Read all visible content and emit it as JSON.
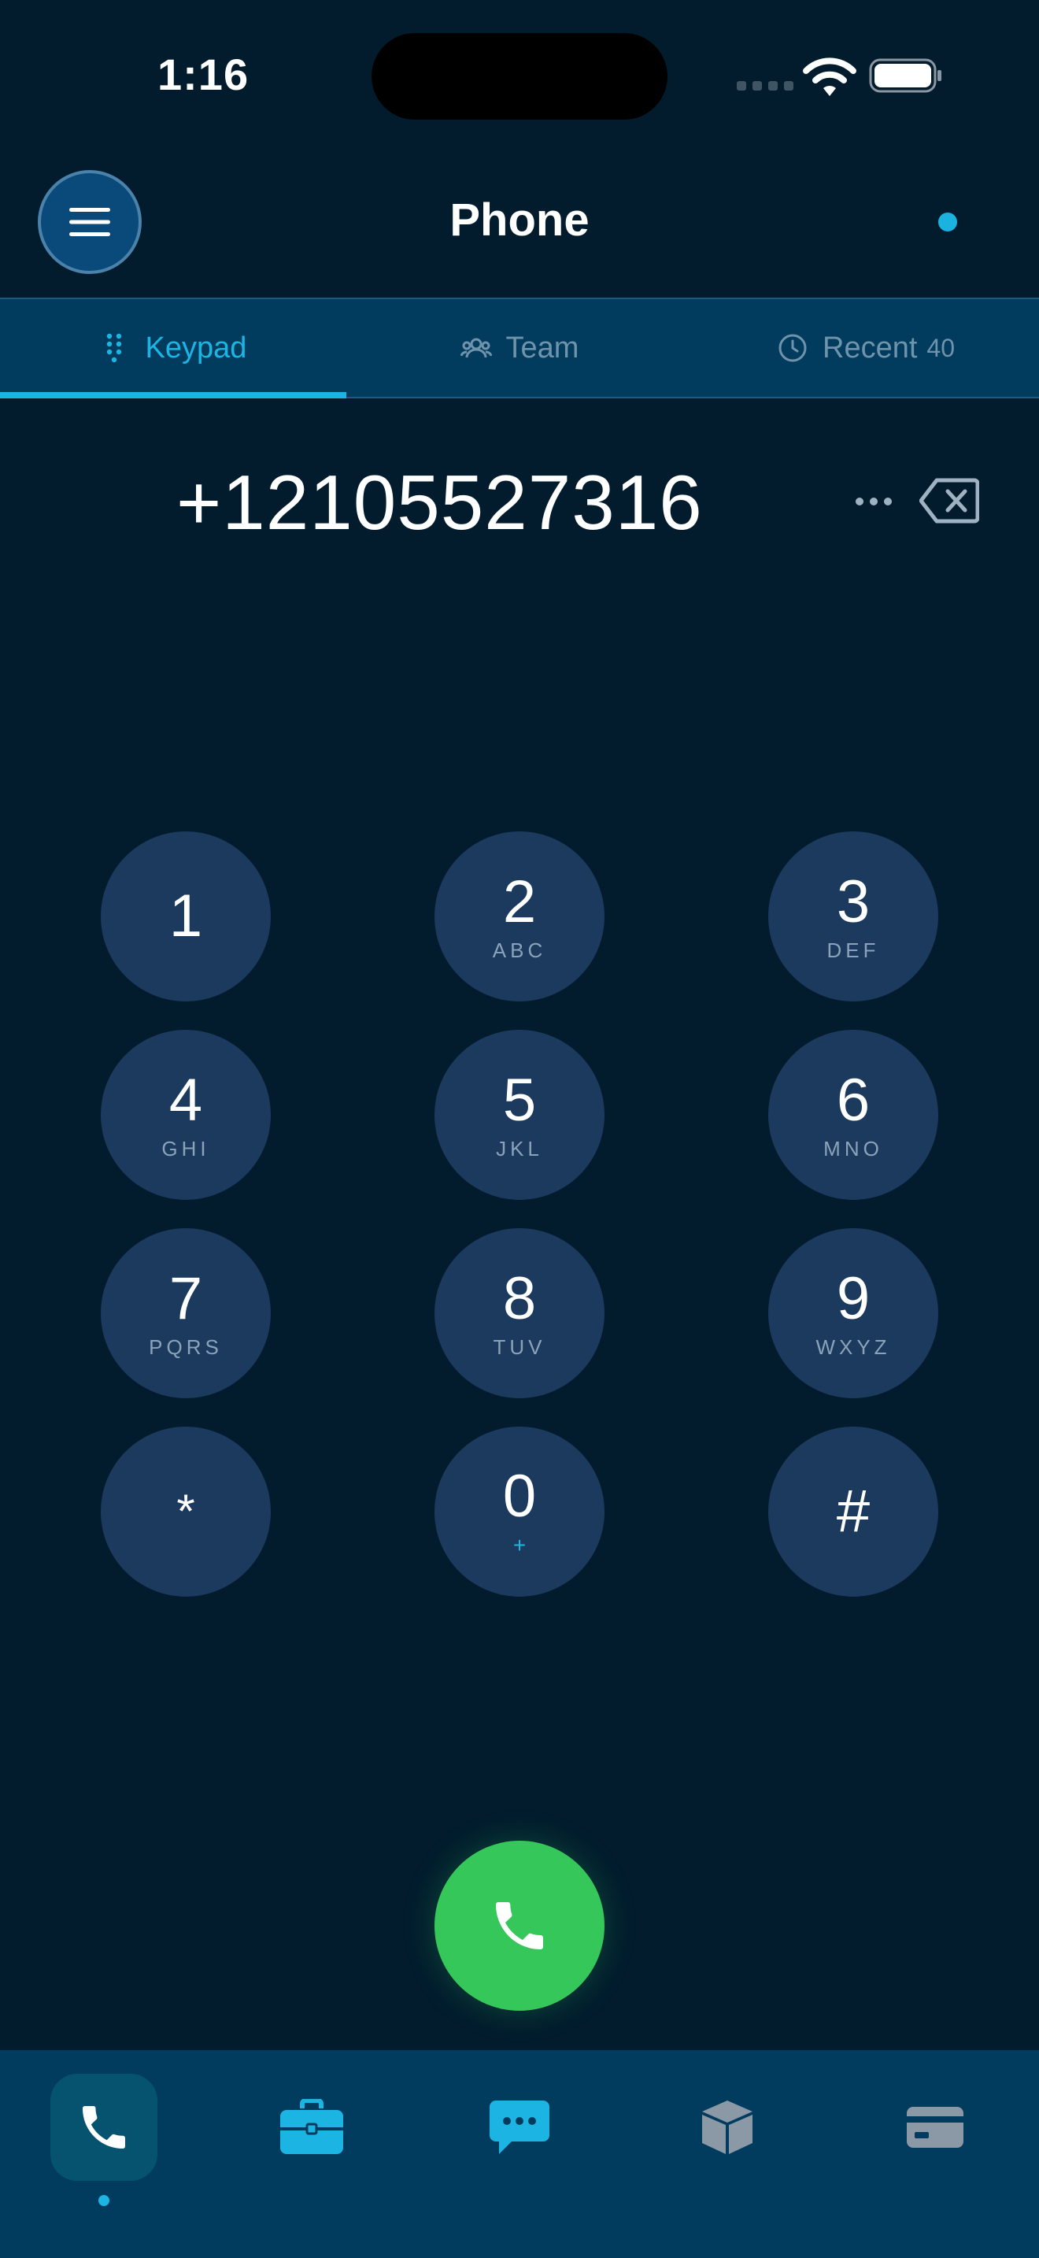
{
  "status_bar": {
    "time": "1:16"
  },
  "header": {
    "title": "Phone"
  },
  "tabs": [
    {
      "label": "Keypad",
      "icon": "keypad-icon",
      "active": true
    },
    {
      "label": "Team",
      "icon": "team-icon",
      "active": false
    },
    {
      "label": "Recent",
      "icon": "clock-icon",
      "count": "40",
      "active": false
    }
  ],
  "dialer": {
    "number": "+12105527316"
  },
  "keypad": [
    {
      "digit": "1",
      "letters": ""
    },
    {
      "digit": "2",
      "letters": "ABC"
    },
    {
      "digit": "3",
      "letters": "DEF"
    },
    {
      "digit": "4",
      "letters": "GHI"
    },
    {
      "digit": "5",
      "letters": "JKL"
    },
    {
      "digit": "6",
      "letters": "MNO"
    },
    {
      "digit": "7",
      "letters": "PQRS"
    },
    {
      "digit": "8",
      "letters": "TUV"
    },
    {
      "digit": "9",
      "letters": "WXYZ"
    },
    {
      "digit": "*",
      "letters": ""
    },
    {
      "digit": "0",
      "letters": "+"
    },
    {
      "digit": "#",
      "letters": ""
    }
  ],
  "bottom_nav": [
    {
      "icon": "phone-icon",
      "active": true
    },
    {
      "icon": "briefcase-icon",
      "active": false
    },
    {
      "icon": "chat-icon",
      "active": false
    },
    {
      "icon": "box-icon",
      "active": false
    },
    {
      "icon": "card-icon",
      "active": false
    }
  ],
  "colors": {
    "background": "#021c2d",
    "accent": "#1cb4e3",
    "key": "#1b3a5d",
    "call": "#35c759",
    "nav_bar": "#013c5e"
  }
}
